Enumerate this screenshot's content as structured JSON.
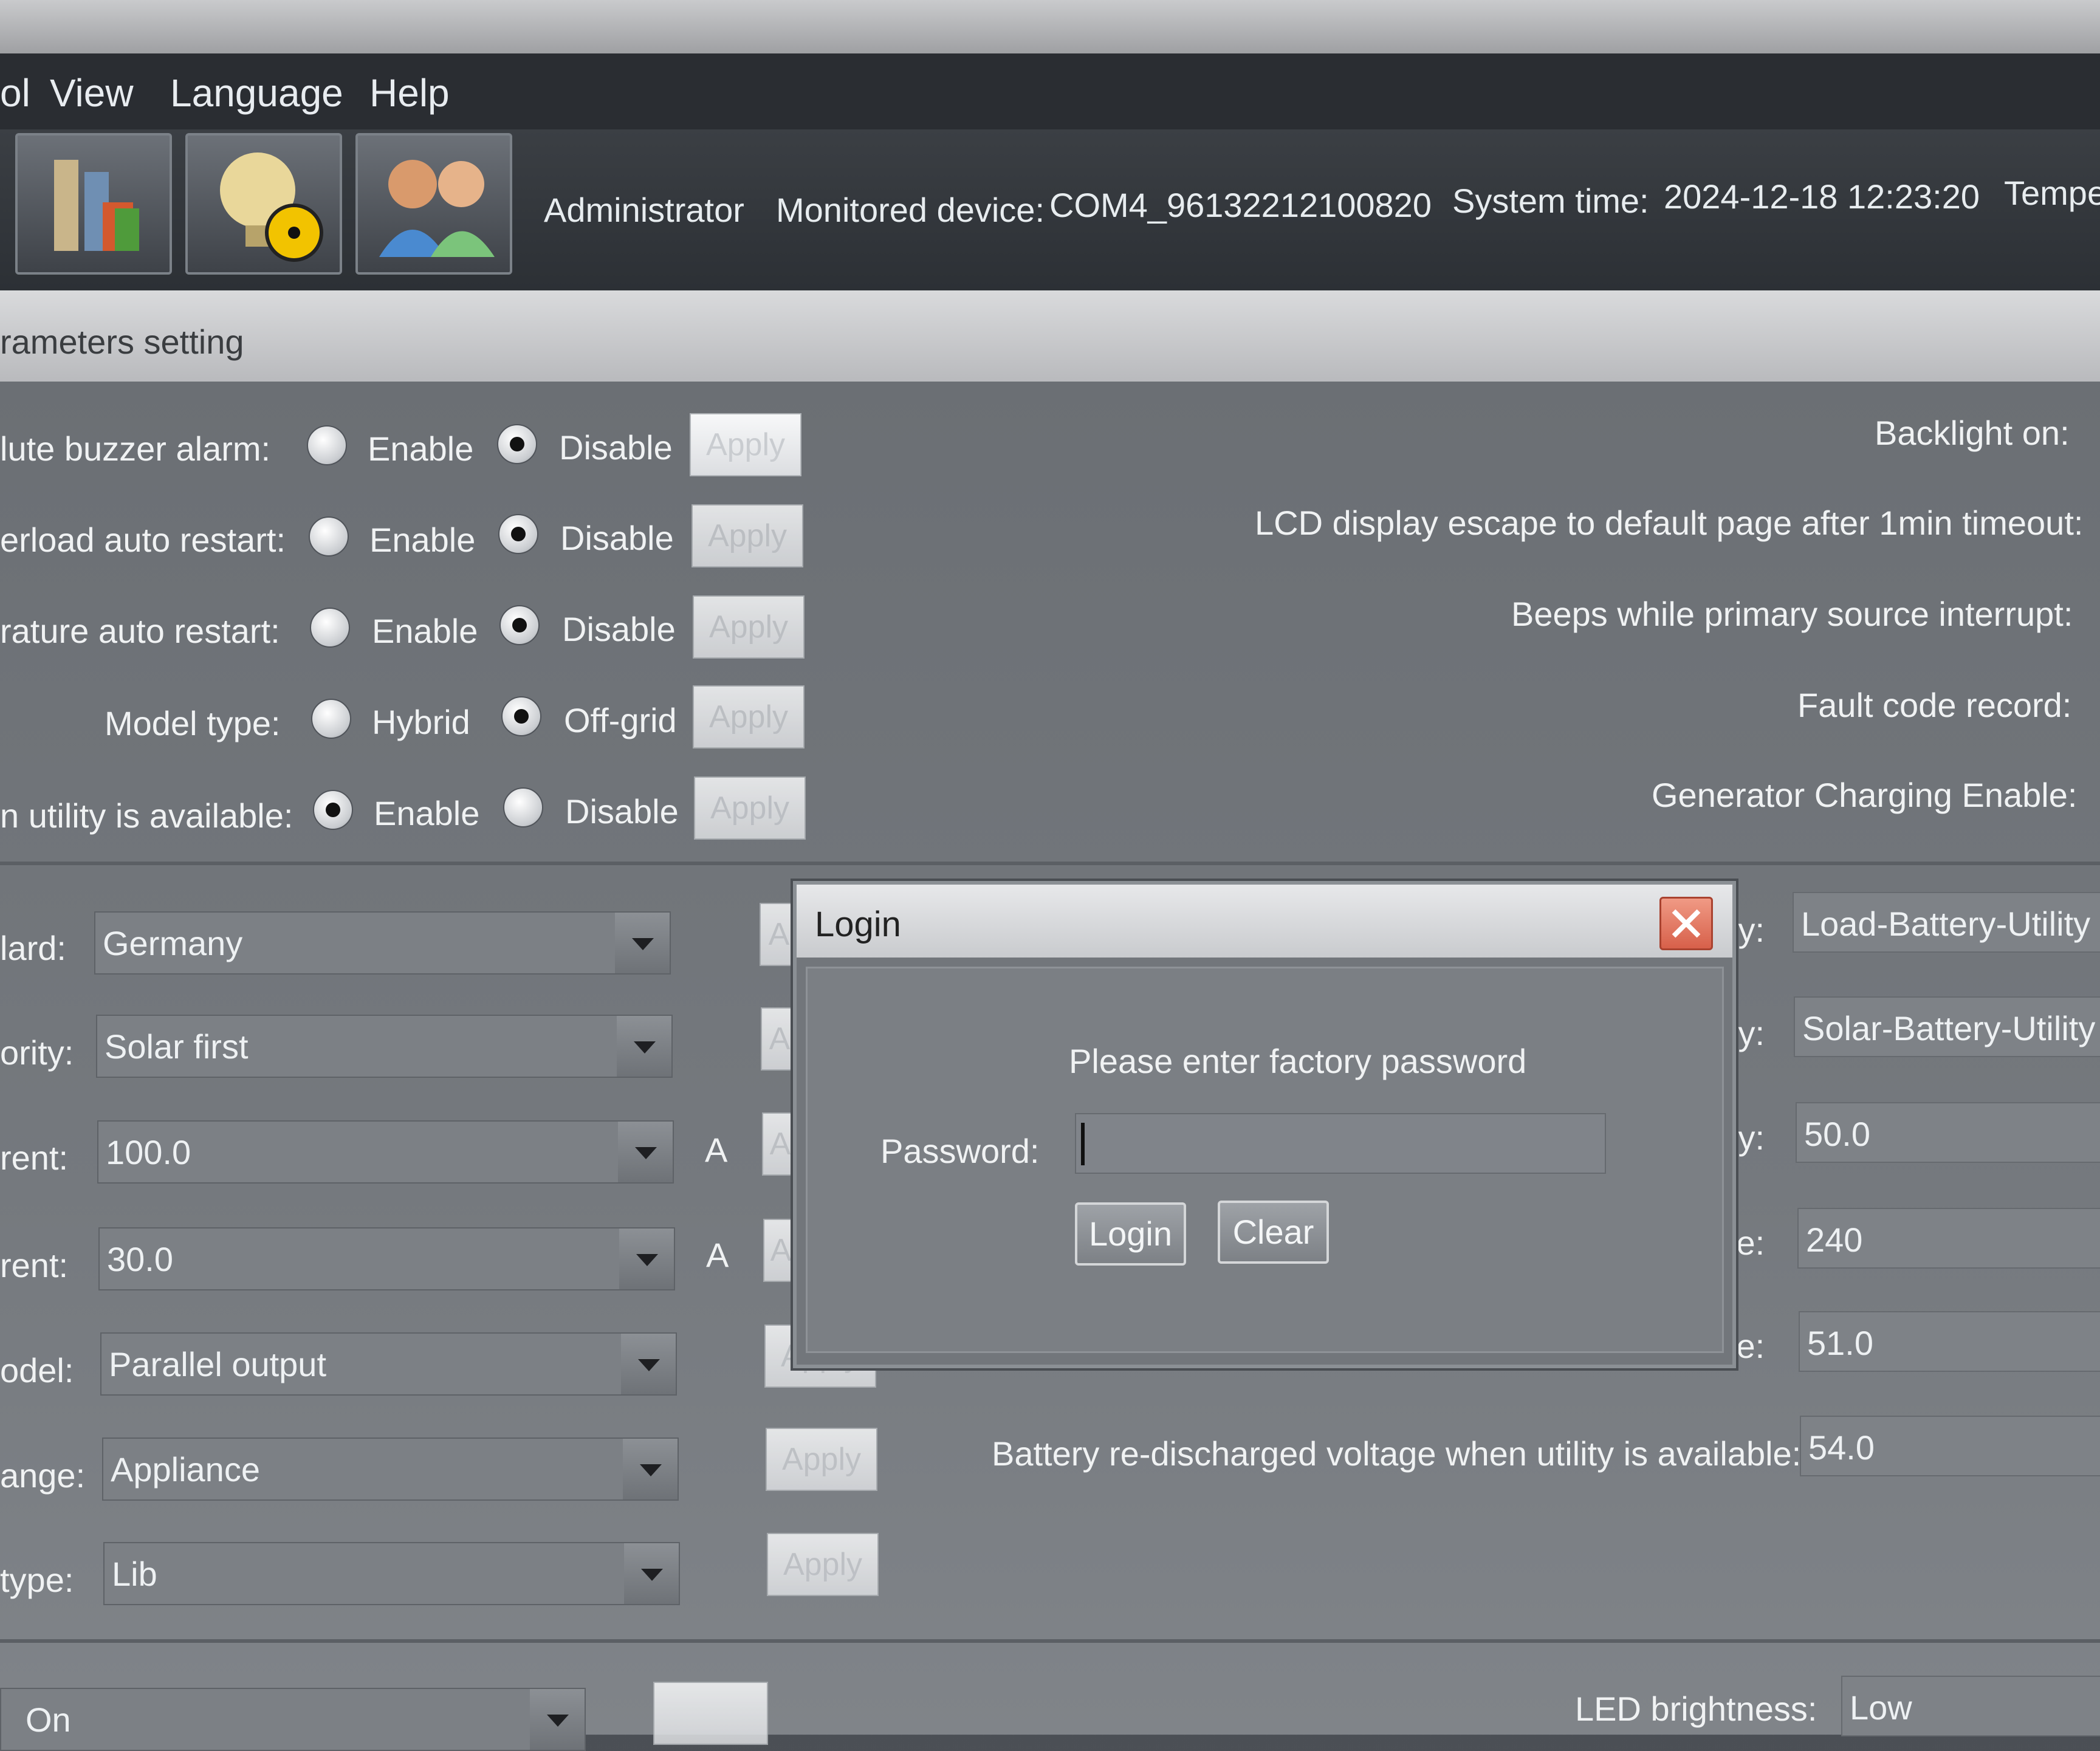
{
  "menu": [
    "ol",
    "View",
    "Language",
    "Help"
  ],
  "status": {
    "user": "Administrator",
    "device_label": "Monitored device:",
    "device_value": "COM4_96132212100820",
    "time_label": "System time:",
    "time_value": "2024-12-18 12:23:20",
    "temp_label": "Tempe"
  },
  "section_title": "rameters setting",
  "radio_rows": [
    {
      "label": "lute buzzer alarm:",
      "opt1": "Enable",
      "opt2": "Disable",
      "selected": 2,
      "apply": "Apply"
    },
    {
      "label": "erload auto restart:",
      "opt1": "Enable",
      "opt2": "Disable",
      "selected": 2,
      "apply": "Apply"
    },
    {
      "label": "rature auto restart:",
      "opt1": "Enable",
      "opt2": "Disable",
      "selected": 2,
      "apply": "Apply"
    },
    {
      "label": "Model type:",
      "opt1": "Hybrid",
      "opt2": "Off-grid",
      "selected": 2,
      "apply": "Apply"
    },
    {
      "label": "n utility is available:",
      "opt1": "Enable",
      "opt2": "Disable",
      "selected": 1,
      "apply": "Apply"
    }
  ],
  "right_labels": [
    "Backlight on:",
    "LCD display escape to default page after 1min timeout:",
    "Beeps while primary source interrupt:",
    "Fault code record:",
    "Generator Charging Enable:"
  ],
  "combo_rows": [
    {
      "label": "lard:",
      "value": "Germany",
      "unit": "",
      "apply": "A"
    },
    {
      "label": "ority:",
      "value": "Solar first",
      "unit": "",
      "apply": "A"
    },
    {
      "label": "rent:",
      "value": "100.0",
      "unit": "A",
      "apply": "A"
    },
    {
      "label": "rent:",
      "value": "30.0",
      "unit": "A",
      "apply": "A"
    },
    {
      "label": "odel:",
      "value": "Parallel output",
      "unit": "",
      "apply": "Apply"
    },
    {
      "label": "ange:",
      "value": "Appliance",
      "unit": "",
      "apply": "Apply"
    },
    {
      "label": "type:",
      "value": "Lib",
      "unit": "",
      "apply": "Apply"
    }
  ],
  "right_fields": [
    {
      "label": "ty:",
      "value": "Load-Battery-Utility"
    },
    {
      "label": "ty:",
      "value": "Solar-Battery-Utility"
    },
    {
      "label": "ty:",
      "value": "50.0"
    },
    {
      "label": "je:",
      "value": "240"
    },
    {
      "label": "le:",
      "value": "51.0"
    },
    {
      "label": "Battery re-discharged voltage when utility is available:",
      "value": "54.0"
    }
  ],
  "bottom": {
    "combo_value": "On",
    "led_label": "LED brightness:",
    "led_value": "Low"
  },
  "dialog": {
    "title": "Login",
    "prompt": "Please enter factory password",
    "password_label": "Password:",
    "password_value": "",
    "login_button": "Login",
    "clear_button": "Clear"
  }
}
